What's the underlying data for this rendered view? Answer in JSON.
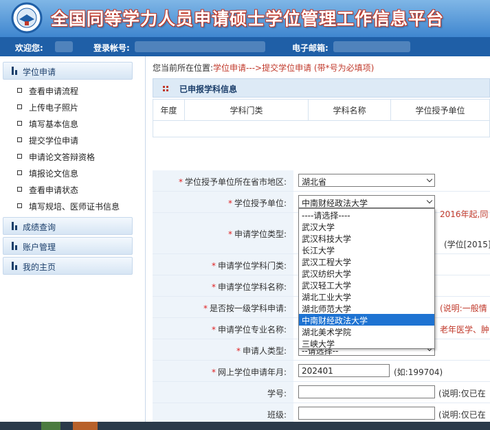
{
  "header": {
    "title": "全国同等学力人员申请硕士学位管理工作信息平台",
    "welcome_label": "欢迎您:",
    "account_label": "登录帐号:",
    "email_label": "电子邮箱:"
  },
  "sidebar": {
    "sections": [
      {
        "label": "学位申请"
      },
      {
        "label": "成绩查询"
      },
      {
        "label": "账户管理"
      },
      {
        "label": "我的主页"
      }
    ],
    "items": [
      {
        "label": "查看申请流程"
      },
      {
        "label": "上传电子照片"
      },
      {
        "label": "填写基本信息"
      },
      {
        "label": "提交学位申请"
      },
      {
        "label": "申请论文答辩资格"
      },
      {
        "label": "填报论文信息"
      },
      {
        "label": "查看申请状态"
      },
      {
        "label": "填写规培、医师证书信息"
      }
    ]
  },
  "breadcrumb": {
    "prefix": "您当前所在位置:",
    "path": "学位申请--->提交学位申请 (带*号为必填项)"
  },
  "panel": {
    "title": "已申报学科信息",
    "columns": [
      "年度",
      "学科门类",
      "学科名称",
      "学位授予单位"
    ]
  },
  "form": {
    "region_label": "学位授予单位所在省市地区:",
    "region_value": "湖北省",
    "unit_label": "学位授予单位:",
    "unit_value": "中南财经政法大学",
    "degree_type_label": "申请学位类型:",
    "degree_type_note1": "2016年起,同",
    "degree_type_note2": "(学位[2015]",
    "category_label": "申请学位学科门类:",
    "subject_label": "申请学位学科名称:",
    "first_level_label": "是否按一级学科申请:",
    "first_level_note": "(说明:一般情",
    "major_label": "申请学位专业名称:",
    "major_note": "老年医学、肿",
    "applicant_type_label": "申请人类型:",
    "applicant_type_value": "--请选择--",
    "year_label": "网上学位申请年月:",
    "year_value": "202401",
    "year_hint": "(如:199704)",
    "student_no_label": "学号:",
    "student_no_note": "(说明:仅已在",
    "class_label": "班级:",
    "class_note": "(说明:仅已在"
  },
  "dropdown": {
    "options": [
      "----请选择----",
      "武汉大学",
      "武汉科技大学",
      "长江大学",
      "武汉工程大学",
      "武汉纺织大学",
      "武汉轻工大学",
      "湖北工业大学",
      "湖北师范大学",
      "中南财经政法大学",
      "湖北美术学院",
      "三峡大学"
    ],
    "selected_index": 9
  },
  "colors": {
    "header_blue": "#3f86cf",
    "userbar_blue": "#1f5fa7",
    "required_red": "#e02020",
    "selection_blue": "#1e73d2"
  }
}
